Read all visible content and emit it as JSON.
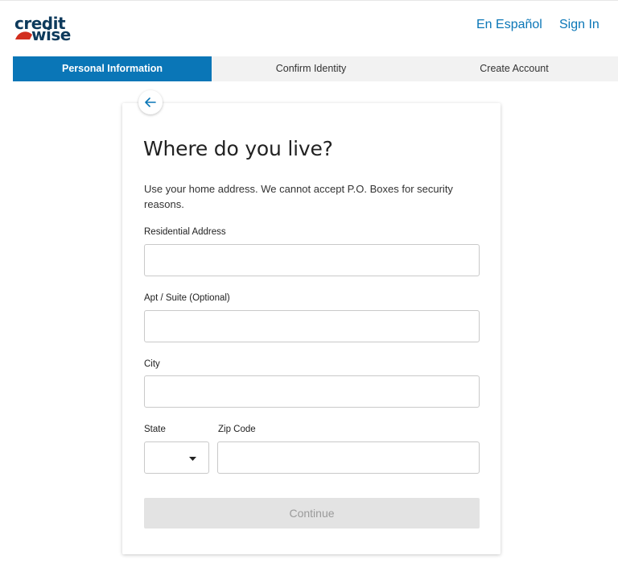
{
  "header": {
    "logo_top": "credit",
    "logo_bottom": "wise",
    "espanol_link": "En Español",
    "signin_link": "Sign In"
  },
  "steps": [
    {
      "label": "Personal Information",
      "active": true
    },
    {
      "label": "Confirm Identity",
      "active": false
    },
    {
      "label": "Create Account",
      "active": false
    }
  ],
  "form": {
    "title": "Where do you live?",
    "description": "Use your home address. We cannot accept P.O. Boxes for security reasons.",
    "fields": {
      "address_label": "Residential Address",
      "address_value": "",
      "apt_label": "Apt / Suite (Optional)",
      "apt_value": "",
      "city_label": "City",
      "city_value": "",
      "state_label": "State",
      "state_value": "",
      "zip_label": "Zip Code",
      "zip_value": ""
    },
    "continue_label": "Continue"
  },
  "colors": {
    "accent": "#0a76b7",
    "logo_text": "#0d3a5c",
    "logo_swoosh": "#d22e1e",
    "disabled_button": "#e3e3e3"
  },
  "icons": {
    "back": "arrow-left-icon",
    "state_caret": "caret-down-icon"
  }
}
